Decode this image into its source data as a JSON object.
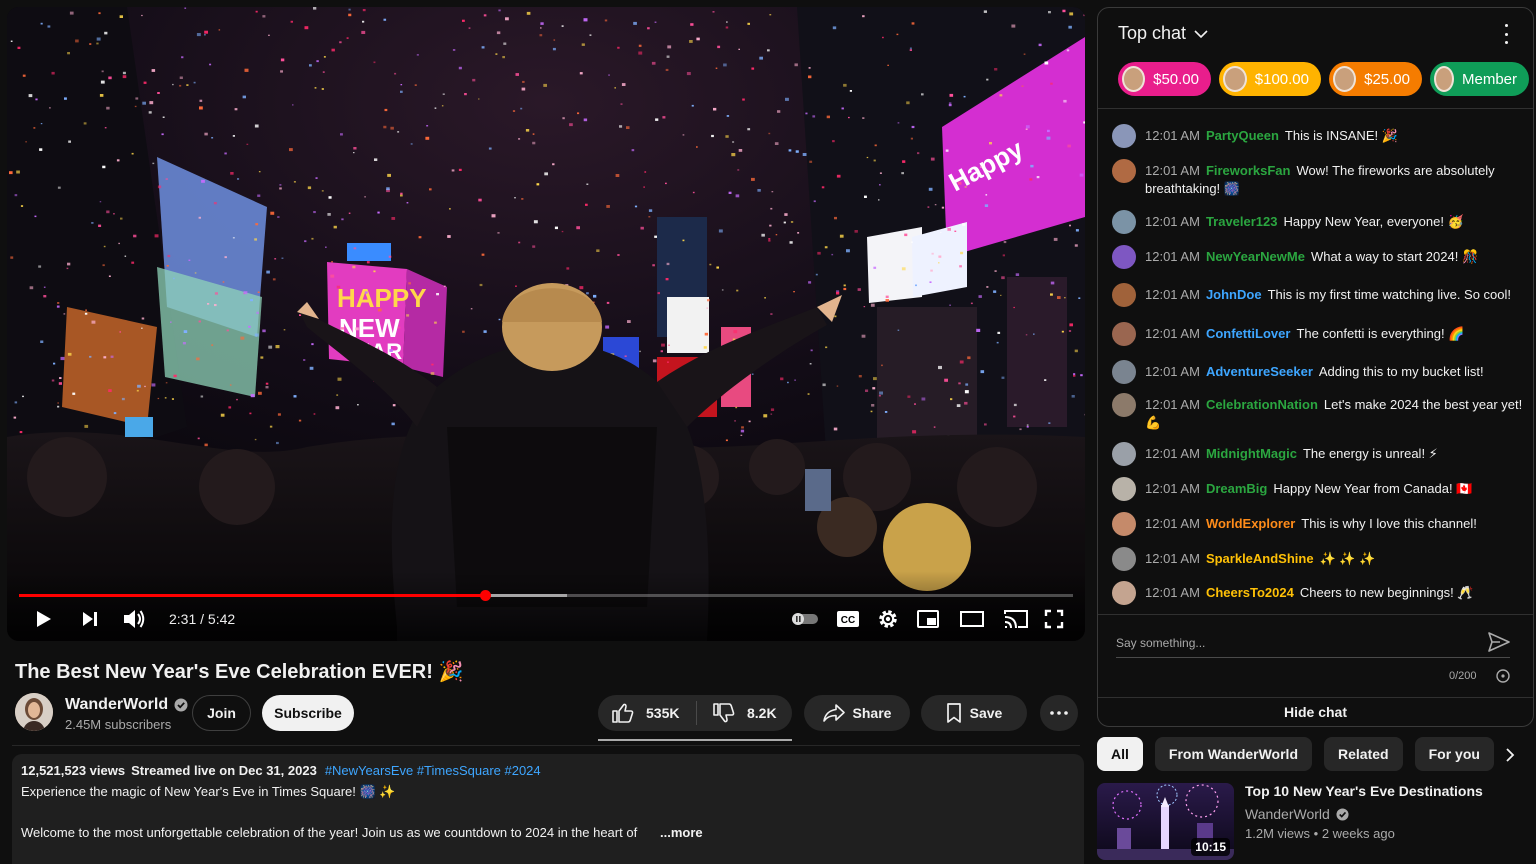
{
  "player": {
    "time_current": "2:31",
    "time_separator": "/",
    "time_total": "5:42",
    "progress_fraction": 0.442,
    "buffered_fraction": 0.52
  },
  "video": {
    "title": "The Best New Year's Eve Celebration EVER! 🎉"
  },
  "channel": {
    "name": "WanderWorld",
    "subscribers": "2.45M subscribers",
    "join_label": "Join",
    "subscribe_label": "Subscribe"
  },
  "actions": {
    "likes": "535K",
    "dislikes": "8.2K",
    "share_label": "Share",
    "save_label": "Save"
  },
  "description": {
    "views": "12,521,523 views",
    "streamed": "Streamed live on Dec 31, 2023",
    "hashtags": "#NewYearsEve #TimesSquare #2024",
    "line1": "Experience the magic of New Year's Eve in Times Square! 🎆 ✨",
    "line2": "Welcome to the most unforgettable celebration of the year! Join us as we countdown to 2024 in the heart of",
    "more": "...more"
  },
  "chat": {
    "header": "Top chat",
    "tickers": [
      {
        "label": "$50.00",
        "color": "#e91e8c"
      },
      {
        "label": "$100.00",
        "color": "#ffb300"
      },
      {
        "label": "$25.00",
        "color": "#f57c00"
      },
      {
        "label": "Member",
        "color": "#0f9d58"
      }
    ],
    "messages": [
      {
        "time": "12:01 AM",
        "author": "PartyQueen",
        "text": "This is INSANE! 🎉",
        "color": "#2ba640",
        "avatar": "#8a96b8"
      },
      {
        "time": "12:01 AM",
        "author": "FireworksFan",
        "text": "Wow! The fireworks are absolutely breathtaking! 🎆",
        "color": "#2ba640",
        "avatar": "#b06a43"
      },
      {
        "time": "12:01 AM",
        "author": "Traveler123",
        "text": "Happy New Year, everyone! 🥳",
        "color": "#2ba640",
        "avatar": "#7b93a6"
      },
      {
        "time": "12:01 AM",
        "author": "NewYearNewMe",
        "text": "What a way to start 2024! 🎊",
        "color": "#2ba640",
        "avatar": "#7e57c2"
      },
      {
        "time": "12:01 AM",
        "author": "JohnDoe",
        "text": "This is my first time watching live. So cool!",
        "color": "#3ea6ff",
        "avatar": "#a0623a"
      },
      {
        "time": "12:01 AM",
        "author": "ConfettiLover",
        "text": "The confetti is everything! 🌈",
        "color": "#3ea6ff",
        "avatar": "#9a6650"
      },
      {
        "time": "12:01 AM",
        "author": "AdventureSeeker",
        "text": "Adding this to my bucket list!",
        "color": "#3ea6ff",
        "avatar": "#7a8490"
      },
      {
        "time": "12:01 AM",
        "author": "CelebrationNation",
        "text": "Let's make 2024 the best year yet! 💪",
        "color": "#2ba640",
        "avatar": "#8c7a6a"
      },
      {
        "time": "12:01 AM",
        "author": "MidnightMagic",
        "text": "The energy is unreal! ⚡",
        "color": "#2ba640",
        "avatar": "#9aa0a8"
      },
      {
        "time": "12:01 AM",
        "author": "DreamBig",
        "text": "Happy New Year from Canada! 🇨🇦",
        "color": "#2ba640",
        "avatar": "#b8b2a8"
      },
      {
        "time": "12:01 AM",
        "author": "WorldExplorer",
        "text": "This is why I love this channel!",
        "color": "#ff8c1a",
        "avatar": "#c58a6a"
      },
      {
        "time": "12:01 AM",
        "author": "SparkleAndShine",
        "text": "✨ ✨ ✨",
        "color": "#ffc107",
        "avatar": "#8a8a8a"
      },
      {
        "time": "12:01 AM",
        "author": "CheersTo2024",
        "text": "Cheers to new beginnings! 🥂",
        "color": "#ffc107",
        "avatar": "#c4a490"
      }
    ],
    "input_placeholder": "Say something...",
    "counter": "0/200",
    "hide_label": "Hide chat"
  },
  "chips": [
    "All",
    "From WanderWorld",
    "Related",
    "For you"
  ],
  "related": {
    "title": "Top 10 New Year's Eve Destinations",
    "channel": "WanderWorld",
    "views": "1.2M views",
    "age": "2 weeks ago",
    "duration": "10:15"
  }
}
